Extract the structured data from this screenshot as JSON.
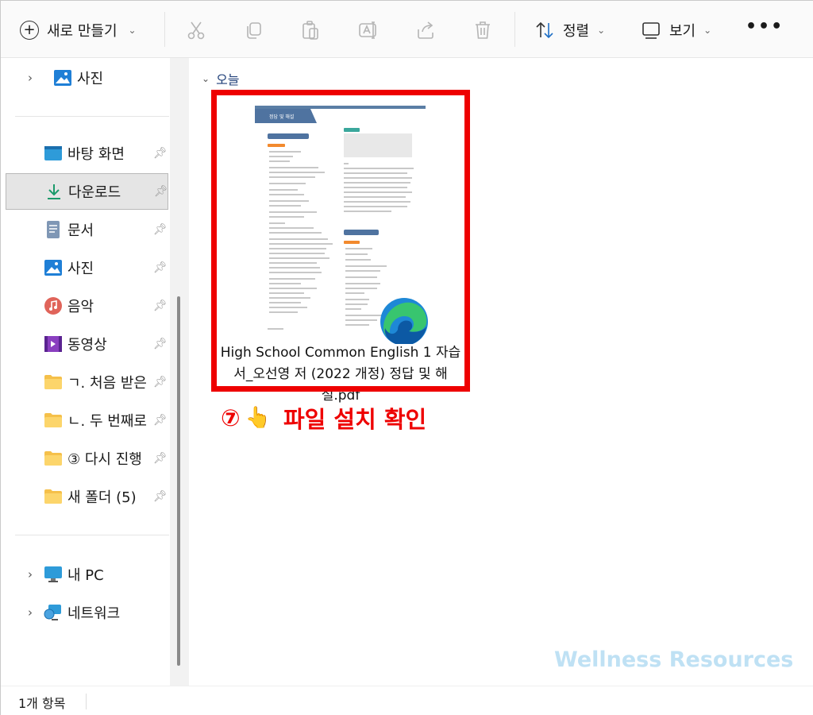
{
  "toolbar": {
    "new_label": "새로 만들기",
    "sort_label": "정렬",
    "view_label": "보기",
    "more_label": "•••"
  },
  "sidebar": {
    "top_item": {
      "label": "사진",
      "icon": "image-icon"
    },
    "quick_access": [
      {
        "label": "바탕 화면",
        "icon": "desktop-icon"
      },
      {
        "label": "다운로드",
        "icon": "download-icon",
        "selected": true
      },
      {
        "label": "문서",
        "icon": "document-icon"
      },
      {
        "label": "사진",
        "icon": "image-icon"
      },
      {
        "label": "음악",
        "icon": "music-icon"
      },
      {
        "label": "동영상",
        "icon": "video-icon"
      },
      {
        "label": "ㄱ. 처음 받은",
        "icon": "folder-icon"
      },
      {
        "label": "ㄴ. 두 번째로",
        "icon": "folder-icon"
      },
      {
        "label": "③ 다시 진행",
        "icon": "folder-icon"
      },
      {
        "label": "새 폴더 (5)",
        "icon": "folder-icon"
      }
    ],
    "bottom_items": [
      {
        "label": "내 PC",
        "icon": "pc-icon"
      },
      {
        "label": "네트워크",
        "icon": "network-icon"
      }
    ]
  },
  "content": {
    "group_label": "오늘",
    "file": {
      "name": "High School Common English 1 자습서_오선영 저 (2022 개정) 정답 및 해설.pdf",
      "name_line1": "High School Common English 1 자습",
      "name_line2": "서_오선영 저 (2022 개정) 정답 및 해",
      "name_line3": "설.pdf",
      "thumb_title": "정답 및 해설",
      "app_icon": "edge-icon"
    },
    "annotation": {
      "number": "⑦",
      "hand": "👆",
      "text": "파일 설치 확인"
    },
    "watermark": "Wellness Resources"
  },
  "statusbar": {
    "item_count": "1개 항목"
  },
  "colors": {
    "highlight": "#ee0000",
    "accent": "#1f6fc5",
    "watermark": "#bfe1f4"
  }
}
